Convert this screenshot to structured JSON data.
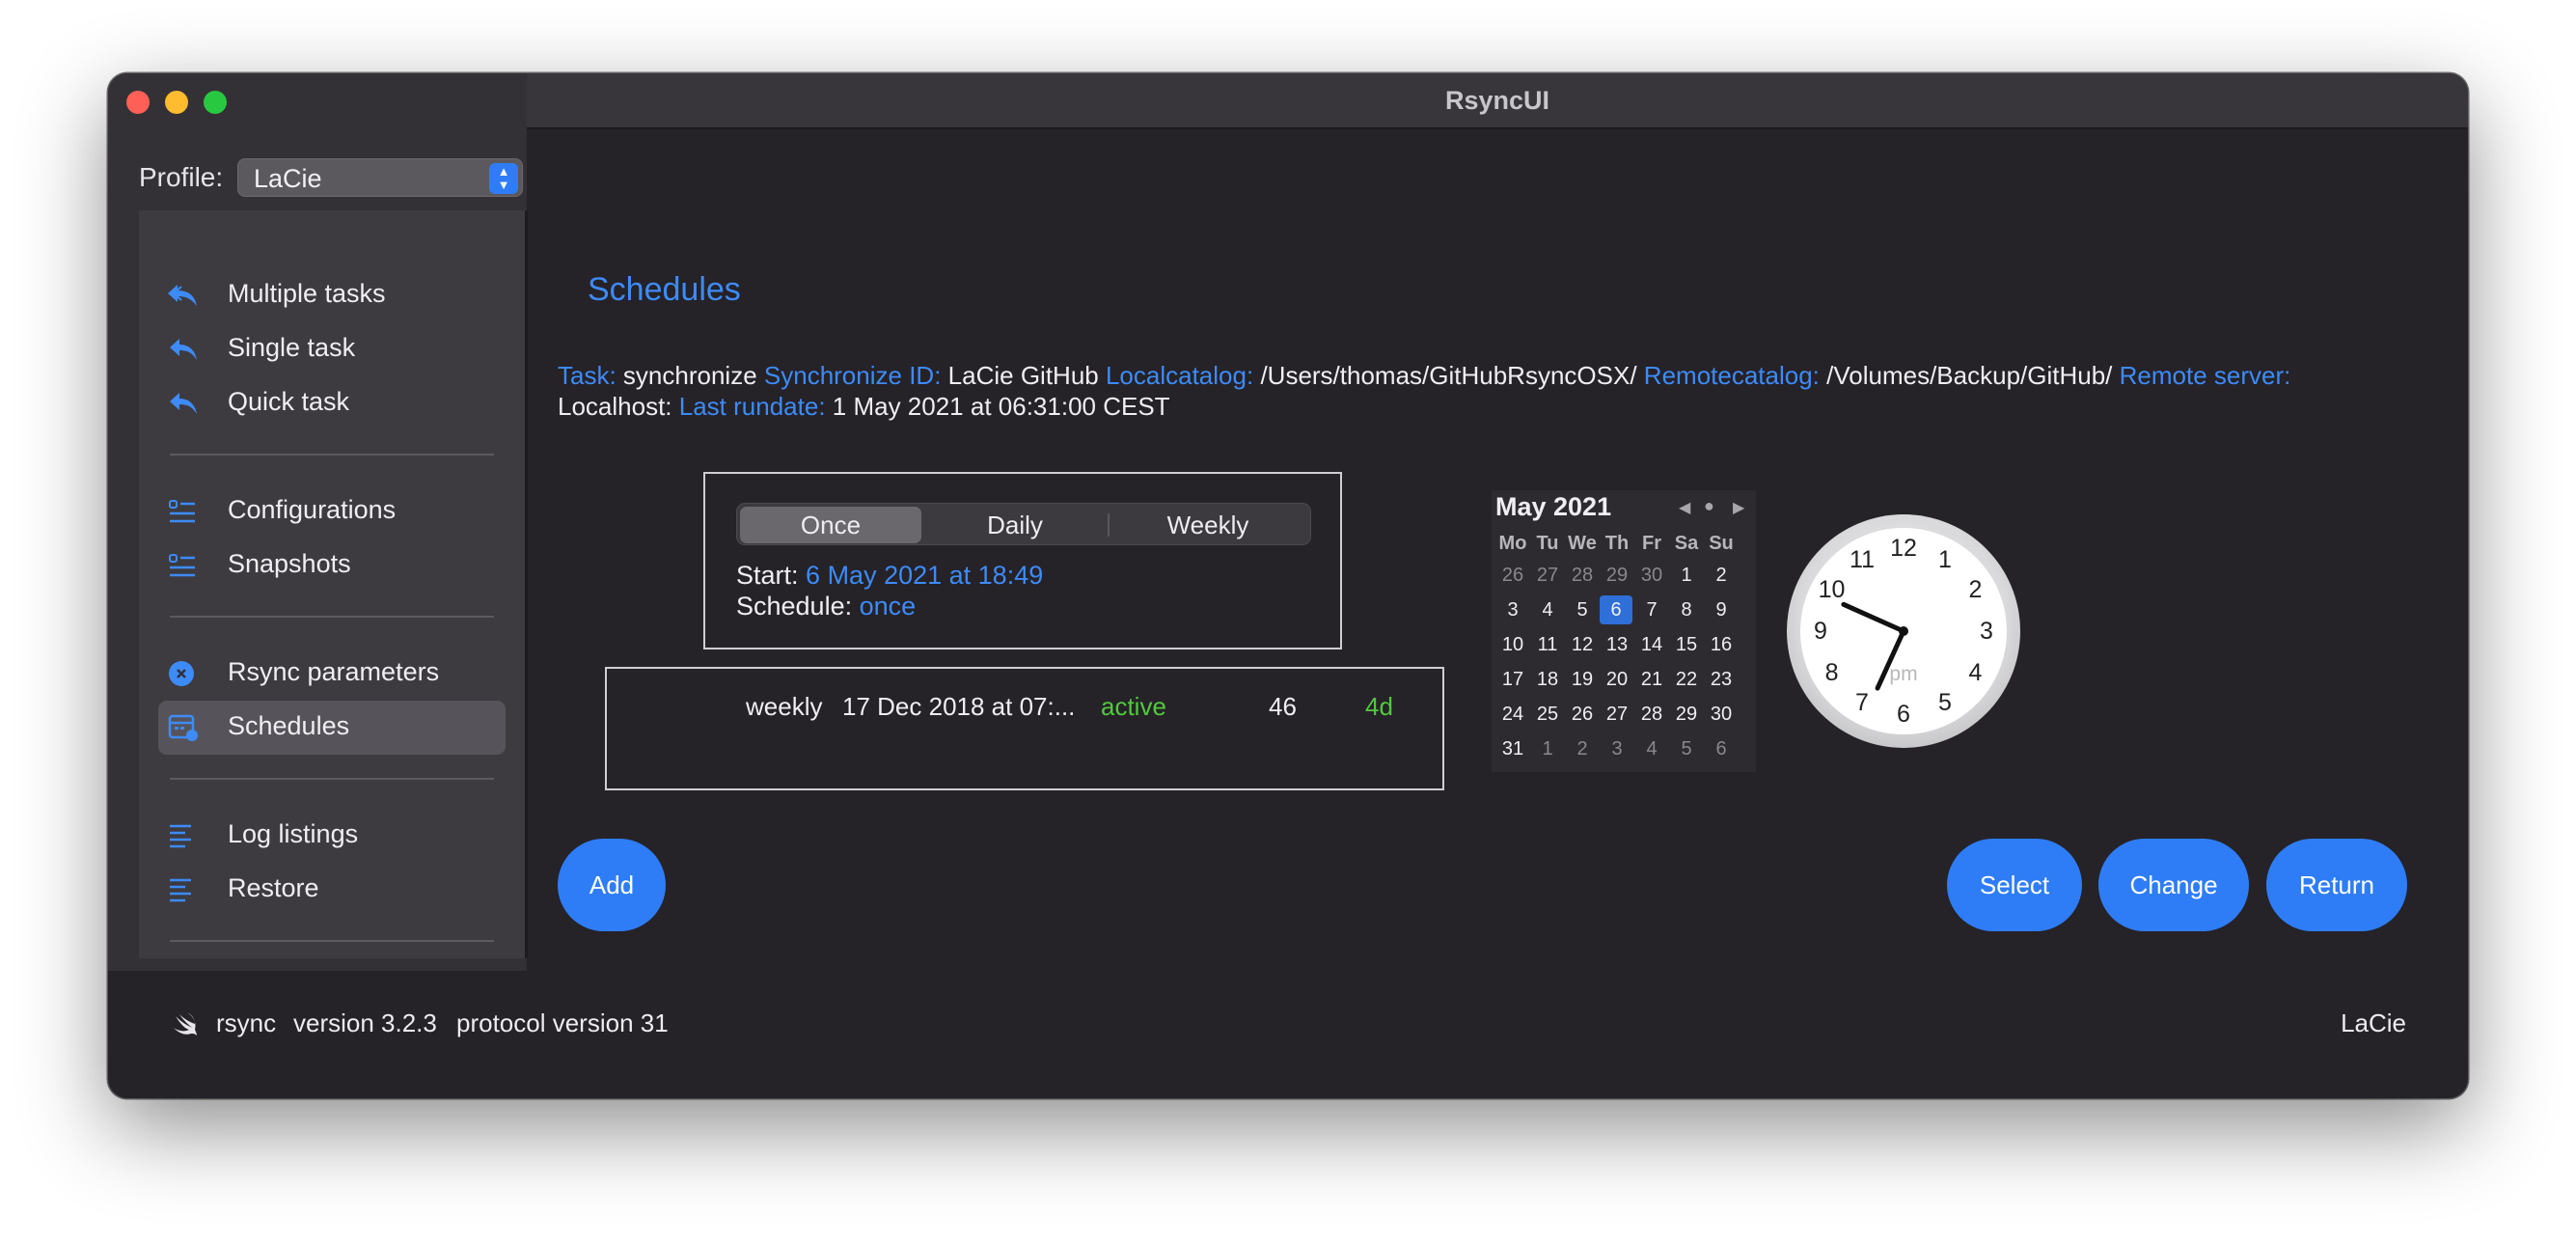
{
  "window": {
    "title": "RsyncUI"
  },
  "profile": {
    "label": "Profile:",
    "value": "LaCie"
  },
  "sidebar": {
    "items": [
      {
        "label": "Multiple tasks",
        "icon": "arrowshape-turn-up-left-2-icon"
      },
      {
        "label": "Single task",
        "icon": "arrowshape-turn-up-left-icon"
      },
      {
        "label": "Quick task",
        "icon": "arrowshape-turn-up-left-icon"
      },
      {
        "label": "Configurations",
        "icon": "list-bullet-rectangle-icon"
      },
      {
        "label": "Snapshots",
        "icon": "list-bullet-rectangle-icon"
      },
      {
        "label": "Rsync parameters",
        "icon": "command-circle-icon"
      },
      {
        "label": "Schedules",
        "icon": "calendar-badge-icon",
        "selected": true
      },
      {
        "label": "Log listings",
        "icon": "text-alignleft-icon"
      },
      {
        "label": "Restore",
        "icon": "text-alignleft-icon"
      }
    ]
  },
  "main": {
    "title": "Schedules",
    "task_info": {
      "task_key": "Task:",
      "task_value": "synchronize",
      "sync_id_key": "Synchronize ID:",
      "sync_id_value": "LaCie GitHub",
      "localcatalog_key": "Localcatalog:",
      "localcatalog_value": "/Users/thomas/GitHubRsyncOSX/",
      "remotecatalog_key": "Remotecatalog:",
      "remotecatalog_value": "/Volumes/Backup/GitHub/",
      "remote_server_key": "Remote server:",
      "remote_server_value": "Localhost:",
      "last_rundate_key": "Last rundate:",
      "last_rundate_value": "1 May 2021 at 06:31:00 CEST"
    },
    "schedule_picker": {
      "options": [
        "Once",
        "Daily",
        "Weekly"
      ],
      "selected": "Once",
      "start_label": "Start:",
      "start_value": "6 May 2021 at 18:49",
      "schedule_label": "Schedule:",
      "schedule_value": "once"
    },
    "schedules_table": {
      "rows": [
        {
          "schedule": "weekly",
          "date": "17 Dec 2018 at 07:...",
          "status": "active",
          "count": "46",
          "delta": "4d"
        }
      ]
    },
    "calendar": {
      "month": "May 2021",
      "days_of_week": [
        "Mo",
        "Tu",
        "We",
        "Th",
        "Fr",
        "Sa",
        "Su"
      ],
      "weeks": [
        [
          "26",
          "27",
          "28",
          "29",
          "30",
          "1",
          "2"
        ],
        [
          "3",
          "4",
          "5",
          "6",
          "7",
          "8",
          "9"
        ],
        [
          "10",
          "11",
          "12",
          "13",
          "14",
          "15",
          "16"
        ],
        [
          "17",
          "18",
          "19",
          "20",
          "21",
          "22",
          "23"
        ],
        [
          "24",
          "25",
          "26",
          "27",
          "28",
          "29",
          "30"
        ],
        [
          "31",
          "1",
          "2",
          "3",
          "4",
          "5",
          "6"
        ]
      ],
      "today": "6"
    },
    "clock": {
      "time": "18:49",
      "period": "pm",
      "numbers": [
        "12",
        "1",
        "2",
        "3",
        "4",
        "5",
        "6",
        "7",
        "8",
        "9",
        "10",
        "11"
      ]
    },
    "buttons": {
      "add": "Add",
      "select": "Select",
      "change": "Change",
      "return": "Return"
    }
  },
  "status_bar": {
    "rsync": "rsync",
    "version": "version 3.2.3",
    "protocol": "protocol version 31",
    "profile": "LaCie"
  },
  "colors": {
    "accent": "#2e7df6",
    "link": "#3d8bf7",
    "active": "#52c93e",
    "background": "#252228"
  }
}
